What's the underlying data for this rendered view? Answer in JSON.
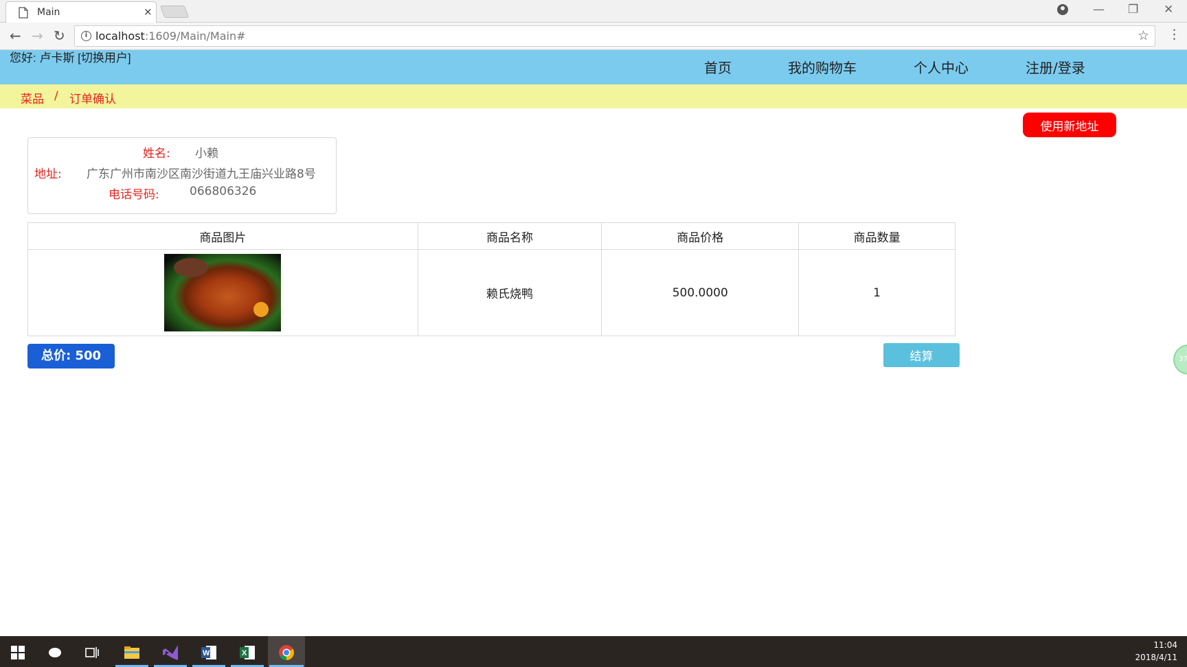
{
  "browser": {
    "tab_title": "Main",
    "tab_close": "×",
    "url_host": "localhost",
    "url_rest": ":1609/Main/Main#",
    "controls": {
      "minimize": "—",
      "restore": "❐",
      "close": "✕"
    },
    "nav": {
      "back": "←",
      "forward": "→",
      "reload": "↻"
    },
    "star": "☆",
    "menu": "⋮"
  },
  "header": {
    "greeting": "您好: 卢卡斯  [切换用户]",
    "nav": [
      "首页",
      "我的购物车",
      "个人中心",
      "注册/登录"
    ],
    "bg_color": "#7bcbef"
  },
  "breadcrumb": {
    "items": [
      "菜品",
      "订单确认"
    ],
    "separator": "/",
    "color": "#e8231e"
  },
  "new_address_button": "使用新地址",
  "address": {
    "name_label": "姓名:",
    "name": "小赖",
    "address_label": "地址:",
    "address": "广东广州市南沙区南沙街道九王庙兴业路8号",
    "phone_label": "电话号码:",
    "phone": "066806326"
  },
  "table": {
    "headers": [
      "商品图片",
      "商品名称",
      "商品价格",
      "商品数量"
    ],
    "rows": [
      {
        "image": "roast-duck-image",
        "name": "赖氏烧鸭",
        "price": "500.0000",
        "qty": "1"
      }
    ]
  },
  "total": "总价: 500",
  "checkout": "结算",
  "float_widget": "37",
  "taskbar": {
    "clock_time": "11:04",
    "clock_date": "2018/4/11",
    "items": [
      "windows-start-icon",
      "cortana-icon",
      "task-view-icon",
      "file-explorer-icon",
      "visual-studio-icon",
      "word-icon",
      "excel-icon",
      "chrome-icon"
    ]
  }
}
